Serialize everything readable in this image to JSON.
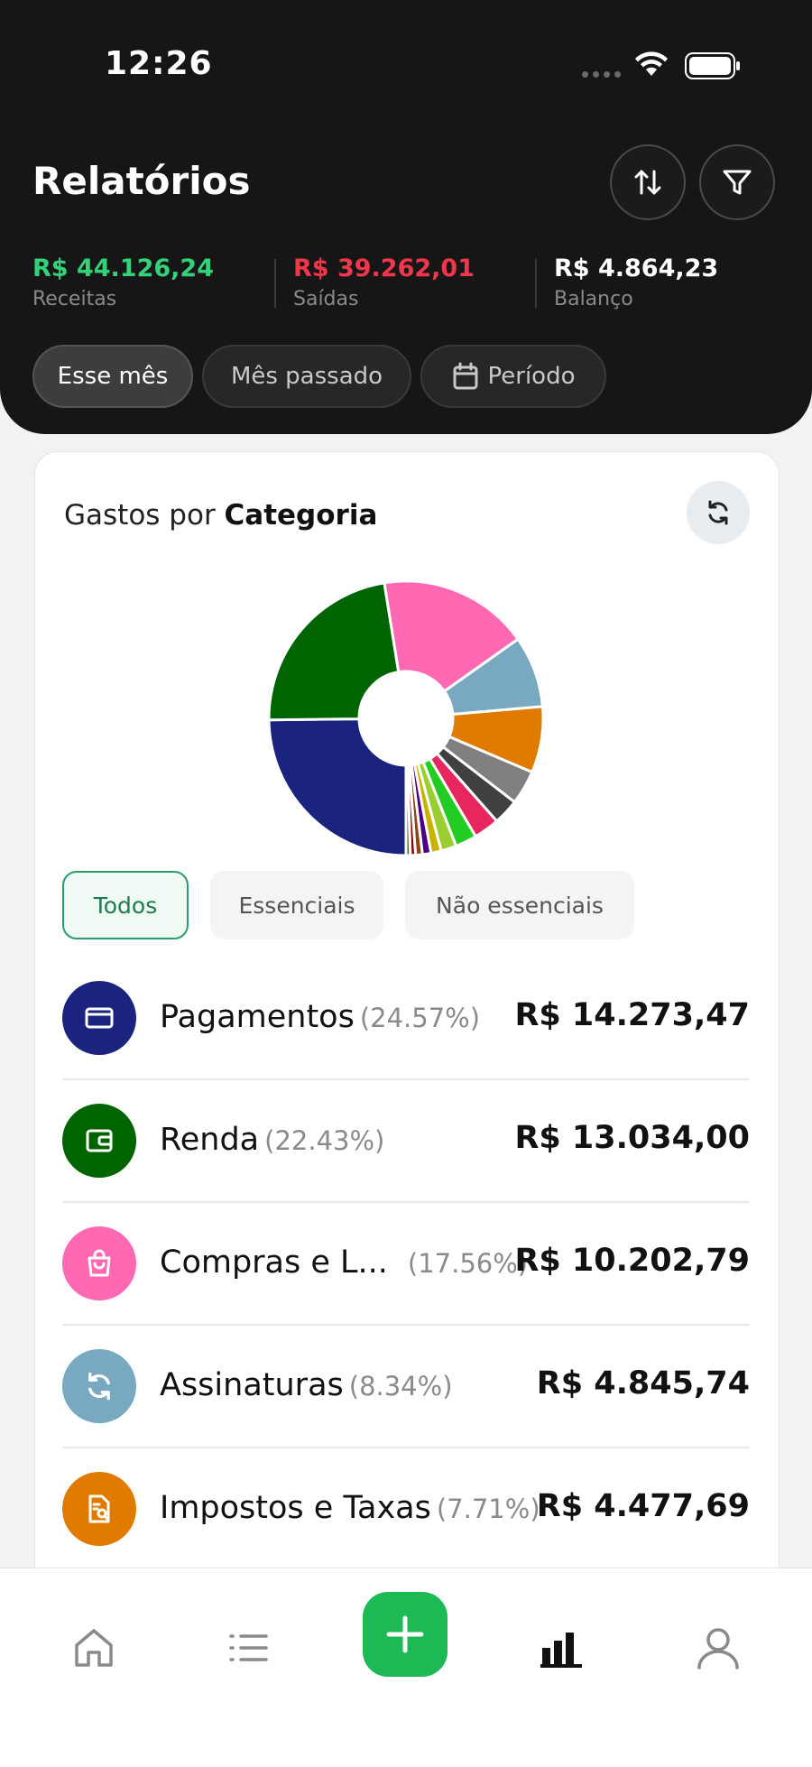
{
  "status_bar": {
    "time": "12:26"
  },
  "header": {
    "title": "Relatórios",
    "summary": [
      {
        "value": "R$ 44.126,24",
        "label": "Receitas",
        "color": "#34d17a"
      },
      {
        "value": "R$ 39.262,01",
        "label": "Saídas",
        "color": "#f0364a"
      },
      {
        "value": "R$ 4.864,23",
        "label": "Balanço",
        "color": "#ffffff"
      }
    ],
    "periods": [
      "Esse mês",
      "Mês passado",
      "Período"
    ],
    "active_period": "Esse mês"
  },
  "card": {
    "title_prefix": "Gastos por ",
    "title_bold": "Categoria",
    "filters": [
      "Todos",
      "Essenciais",
      "Não essenciais"
    ],
    "active_filter": "Todos",
    "categories": [
      {
        "name": "Pagamentos",
        "pct": "(24.57%)",
        "amount": "R$ 14.273,47",
        "color": "#1a237e",
        "icon": "card-icon"
      },
      {
        "name": "Renda",
        "pct": "(22.43%)",
        "amount": "R$ 13.034,00",
        "color": "#006400",
        "icon": "wallet-icon"
      },
      {
        "name": "Compras e L...",
        "pct": "(17.56%)",
        "amount": "R$ 10.202,79",
        "color": "#ff69b4",
        "icon": "shopping-bag-icon"
      },
      {
        "name": "Assinaturas",
        "pct": "(8.34%)",
        "amount": "R$ 4.845,74",
        "color": "#78a9c0",
        "icon": "subscription-icon"
      },
      {
        "name": "Impostos e Taxas",
        "pct": "(7.71%)",
        "amount": "R$ 4.477,69",
        "color": "#e07b00",
        "icon": "tax-document-icon"
      }
    ],
    "chart_slice_values": [
      24.57,
      22.43,
      17.56,
      8.34,
      7.71,
      4.0,
      3.0,
      3.0,
      2.5,
      1.8,
      1.2,
      1.0,
      0.8,
      0.6,
      0.5
    ],
    "chart_slice_colors": [
      "#1a237e",
      "#006400",
      "#ff69b4",
      "#78a9c0",
      "#e07b00",
      "#808080",
      "#404040",
      "#e8265e",
      "#22cc22",
      "#9acd32",
      "#c8b400",
      "#4b0082",
      "#8b4513",
      "#8b0000",
      "#556b2f"
    ]
  },
  "tabbar": {
    "items": [
      "home-icon",
      "list-icon",
      "add-icon",
      "reports-icon",
      "profile-icon"
    ],
    "active": "reports-icon",
    "fab_color": "#1db954"
  }
}
